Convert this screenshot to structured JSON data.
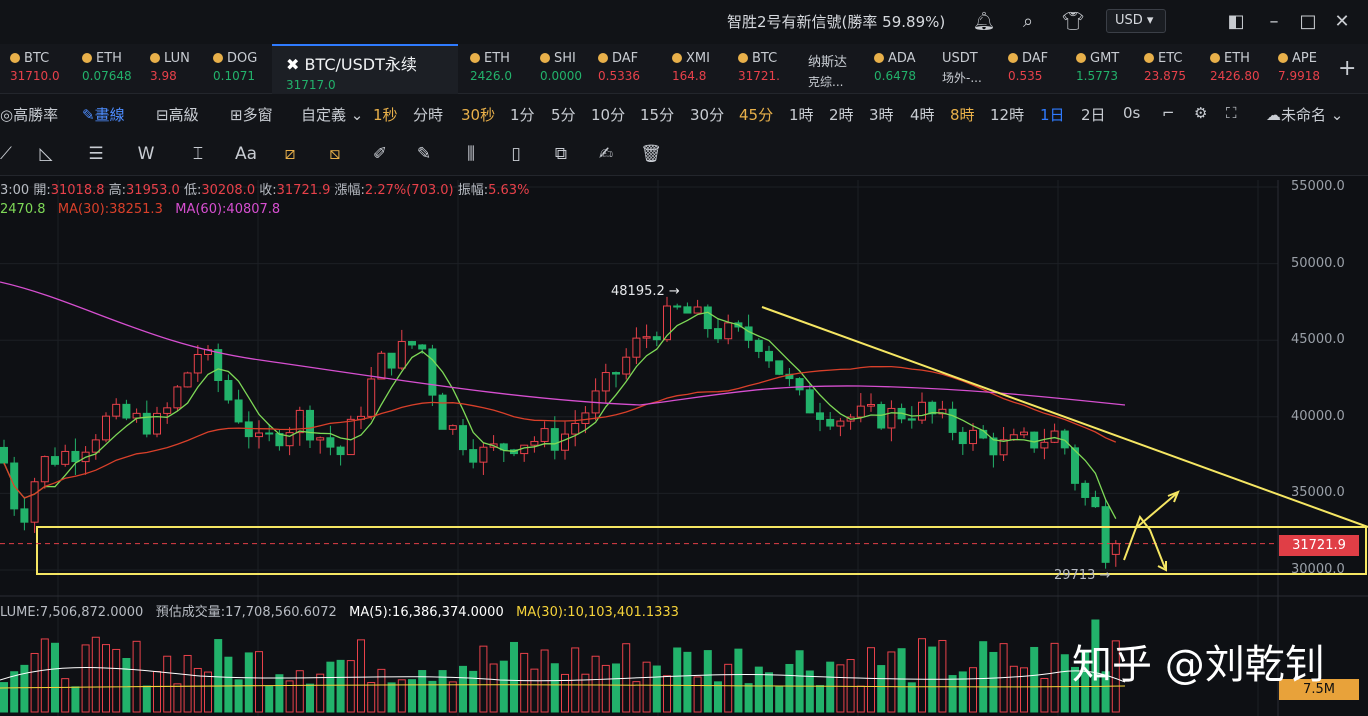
{
  "titlebar": {
    "brand_text": "智胜2号有新信號(勝率 59.89%)",
    "currency": "USD ▾",
    "icons": [
      "bell-icon",
      "search-icon",
      "shirt-icon",
      "layout-icon",
      "minimize-icon",
      "maximize-icon",
      "close-icon"
    ]
  },
  "tickers": [
    {
      "sym": "BTC",
      "price": "31710.0",
      "dir": "down"
    },
    {
      "sym": "ETH",
      "price": "0.07648",
      "dir": "up"
    },
    {
      "sym": "LUN",
      "price": "3.98",
      "dir": "down"
    },
    {
      "sym": "DOG",
      "price": "0.1071",
      "dir": "up"
    },
    {
      "sym": "BTC/USDT永续",
      "price": "31717.0",
      "dir": "up",
      "active": true
    },
    {
      "sym": "ETH",
      "price": "2426.0",
      "dir": "up"
    },
    {
      "sym": "SHI",
      "price": "0.0000",
      "dir": "up"
    },
    {
      "sym": "DAF",
      "price": "0.5336",
      "dir": "down"
    },
    {
      "sym": "XMI",
      "price": "164.8",
      "dir": "down"
    },
    {
      "sym": "BTC",
      "price": "31721.",
      "dir": "down"
    },
    {
      "sym": "纳斯达",
      "price": "克综...",
      "dir": "none"
    },
    {
      "sym": "ADA",
      "price": "0.6478",
      "dir": "up"
    },
    {
      "sym": "USDT",
      "price": "场外-...",
      "dir": "none"
    },
    {
      "sym": "DAF",
      "price": "0.535",
      "dir": "down"
    },
    {
      "sym": "GMT",
      "price": "1.5773",
      "dir": "up"
    },
    {
      "sym": "ETC",
      "price": "23.875",
      "dir": "down"
    },
    {
      "sym": "ETH",
      "price": "2426.80",
      "dir": "down"
    },
    {
      "sym": "APE",
      "price": "7.9918",
      "dir": "down"
    }
  ],
  "toolbar": {
    "high_win": "◎高勝率",
    "draw": "✎畫線",
    "advanced": "⊟高級",
    "multi": "⊞多窗",
    "custom": "自定義 ⌄",
    "timeframes": [
      {
        "label": "1秒",
        "style": "hl"
      },
      {
        "label": "分時",
        "style": ""
      },
      {
        "label": "30秒",
        "style": "hl"
      },
      {
        "label": "1分",
        "style": ""
      },
      {
        "label": "5分",
        "style": ""
      },
      {
        "label": "10分",
        "style": ""
      },
      {
        "label": "15分",
        "style": ""
      },
      {
        "label": "30分",
        "style": ""
      },
      {
        "label": "45分",
        "style": "hl"
      },
      {
        "label": "1時",
        "style": ""
      },
      {
        "label": "2時",
        "style": ""
      },
      {
        "label": "3時",
        "style": ""
      },
      {
        "label": "4時",
        "style": ""
      },
      {
        "label": "8時",
        "style": "hl"
      },
      {
        "label": "12時",
        "style": ""
      },
      {
        "label": "1日",
        "style": "sel"
      },
      {
        "label": "2日",
        "style": ""
      },
      {
        "label": "0s",
        "style": ""
      }
    ],
    "unnamed": "☁未命名 ⌄"
  },
  "ohlc": {
    "prefix": "3:00",
    "open_lbl": "開:",
    "open": "31018.8",
    "high_lbl": "高:",
    "high": "31953.0",
    "low_lbl": "低:",
    "low": "30208.0",
    "close_lbl": "收:",
    "close": "31721.9",
    "chg_lbl": "漲幅:",
    "chg": "2.27%(703.0)",
    "amp_lbl": "振幅:",
    "amp": "5.63%"
  },
  "ma": {
    "ma5": "2470.8",
    "ma30": "MA(30):38251.3",
    "ma60": "MA(60):40807.8",
    "colors": {
      "ma5": "#7ed957",
      "ma30": "#d9402a",
      "ma60": "#d64fd0"
    }
  },
  "volume": {
    "vol": "LUME:7,506,872.0000",
    "est": "預估成交量:17,708,560.6072",
    "ma5": "MA(5):16,386,374.0000",
    "ma30": "MA(30):10,103,401.1333",
    "tag": "7.5M"
  },
  "price_tag": "31721.9",
  "watermark": "知乎 @刘乾钊",
  "chart_data": {
    "type": "candlestick",
    "y_ticks": [
      "55000.0",
      "50000.0",
      "45000.0",
      "40000.0",
      "35000.0",
      "30000.0"
    ],
    "ylim": [
      28000,
      56000
    ],
    "annotations": {
      "high": "48195.2 →",
      "low": "29713 →"
    },
    "last_price": 31721.9,
    "colors": {
      "up": "#e8414a",
      "down": "#22b26b",
      "trend": "#f5e663",
      "box": "#f5e663"
    }
  }
}
